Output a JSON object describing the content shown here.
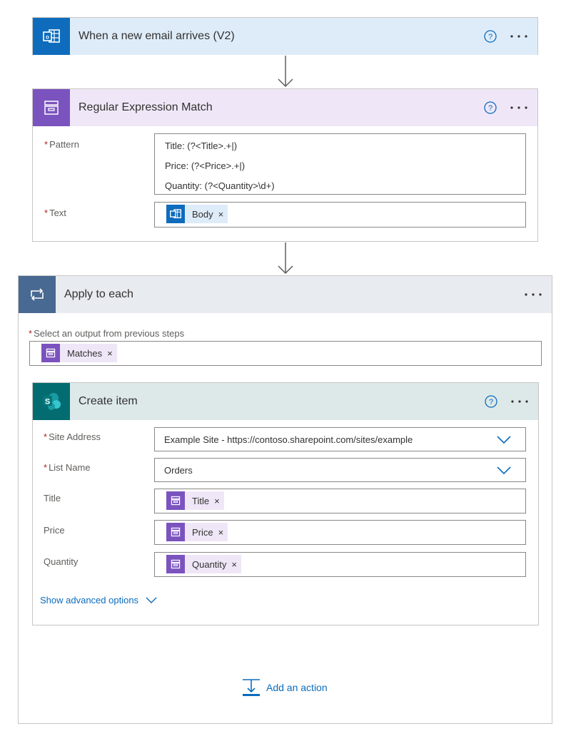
{
  "trigger": {
    "title": "When a new email arrives (V2)",
    "icon": "outlook-icon",
    "header_color": "#deecf9",
    "icon_color": "#0f6cbd"
  },
  "regex": {
    "title": "Regular Expression Match",
    "icon": "regex-box-icon",
    "header_color": "#efe7f7",
    "icon_color": "#7b53bf",
    "pattern_label": "Pattern",
    "pattern_lines": [
      "Title: (?<Title>.+|)",
      "Price: (?<Price>.+|)",
      "Quantity: (?<Quantity>\\d+)"
    ],
    "text_label": "Text",
    "text_token": "Body"
  },
  "loop": {
    "title": "Apply to each",
    "icon": "loop-icon",
    "header_color": "#e8ebf0",
    "icon_color": "#486991",
    "select_label": "Select an output from previous steps",
    "select_token": "Matches"
  },
  "create_item": {
    "title": "Create item",
    "icon": "sharepoint-icon",
    "header_color": "#dde9e9",
    "icon_color": "#036c70",
    "site_label": "Site Address",
    "site_value": "Example Site - https://contoso.sharepoint.com/sites/example",
    "list_label": "List Name",
    "list_value": "Orders",
    "title_label": "Title",
    "title_token": "Title",
    "price_label": "Price",
    "price_token": "Price",
    "quantity_label": "Quantity",
    "quantity_token": "Quantity",
    "advanced_label": "Show advanced options"
  },
  "add_action_label": "Add an action",
  "required_marker": "*",
  "token_remove": "×"
}
